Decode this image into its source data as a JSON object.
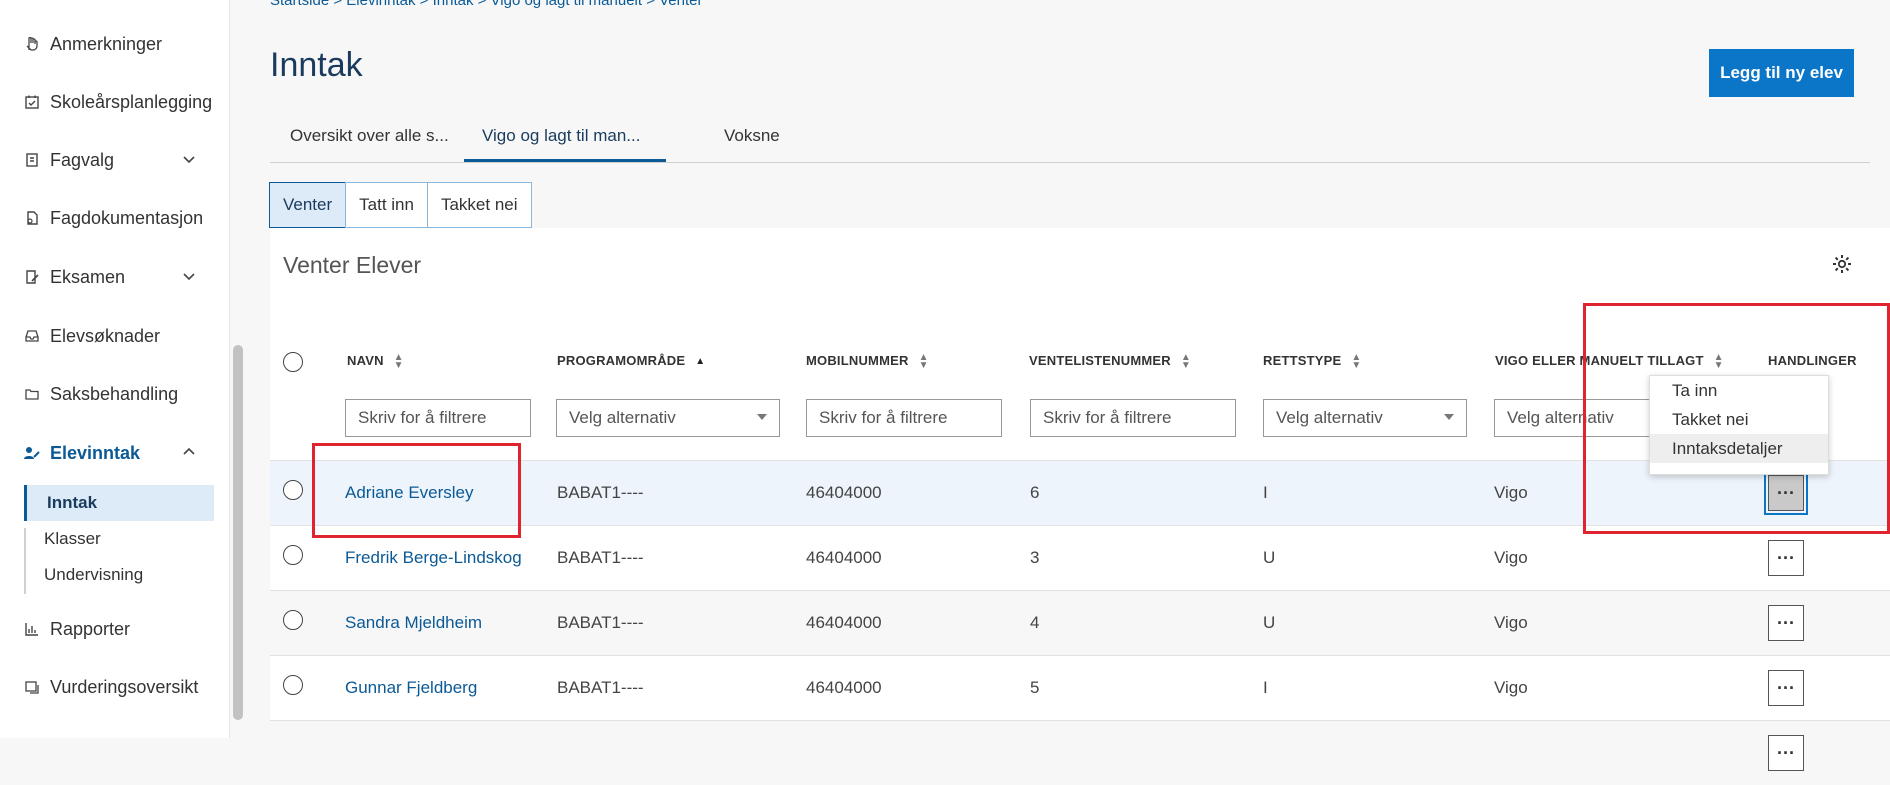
{
  "sidebar": {
    "items": [
      {
        "label": "Anmerkninger"
      },
      {
        "label": "Skoleårsplanlegging"
      },
      {
        "label": "Fagvalg"
      },
      {
        "label": "Fagdokumentasjon"
      },
      {
        "label": "Eksamen"
      },
      {
        "label": "Elevsøknader"
      },
      {
        "label": "Saksbehandling"
      },
      {
        "label": "Elevinntak"
      },
      {
        "label": "Rapporter"
      },
      {
        "label": "Vurderingsoversikt"
      }
    ],
    "sub_items": [
      {
        "label": "Inntak"
      },
      {
        "label": "Klasser"
      },
      {
        "label": "Undervisning"
      }
    ]
  },
  "breadcrumb": {
    "text": "Startside > Elevinntak > Inntak > Vigo og lagt til manuelt > Venter"
  },
  "page": {
    "title": "Inntak",
    "add_button": "Legg til ny elev"
  },
  "tabs": [
    {
      "label": "Oversikt over alle s..."
    },
    {
      "label": "Vigo og lagt til man..."
    },
    {
      "label": "Voksne"
    }
  ],
  "segments": [
    {
      "label": "Venter"
    },
    {
      "label": "Tatt inn"
    },
    {
      "label": "Takket nei"
    }
  ],
  "panel": {
    "title": "Venter Elever"
  },
  "table": {
    "headers": [
      "NAVN",
      "PROGRAMOMRÅDE",
      "MOBILNUMMER",
      "VENTELISTENUMMER",
      "RETTSTYPE",
      "VIGO ELLER MANUELT TILLAGT",
      "HANDLINGER"
    ],
    "filters": [
      {
        "placeholder": "Skriv for å filtrere"
      },
      {
        "placeholder": "Velg alternativ"
      },
      {
        "placeholder": "Skriv for å filtrere"
      },
      {
        "placeholder": "Skriv for å filtrere"
      },
      {
        "placeholder": "Velg alternativ"
      },
      {
        "placeholder": "Velg alternativ"
      }
    ],
    "rows": [
      {
        "name": "Adriane Eversley",
        "program": "BABAT1----",
        "mobile": "46404000",
        "waitlist": "6",
        "right": "I",
        "source": "Vigo"
      },
      {
        "name": "Fredrik Berge-Lindskog",
        "program": "BABAT1----",
        "mobile": "46404000",
        "waitlist": "3",
        "right": "U",
        "source": "Vigo"
      },
      {
        "name": "Sandra Mjeldheim",
        "program": "BABAT1----",
        "mobile": "46404000",
        "waitlist": "4",
        "right": "U",
        "source": "Vigo"
      },
      {
        "name": "Gunnar Fjeldberg",
        "program": "BABAT1----",
        "mobile": "46404000",
        "waitlist": "5",
        "right": "I",
        "source": "Vigo"
      }
    ],
    "action_label": "···"
  },
  "row_menu": {
    "items": [
      "Ta inn",
      "Takket nei",
      "Inntaksdetaljer"
    ]
  },
  "colors": {
    "accent": "#0b5a96",
    "button": "#0b76c8",
    "highlight_box": "#e0242f"
  }
}
